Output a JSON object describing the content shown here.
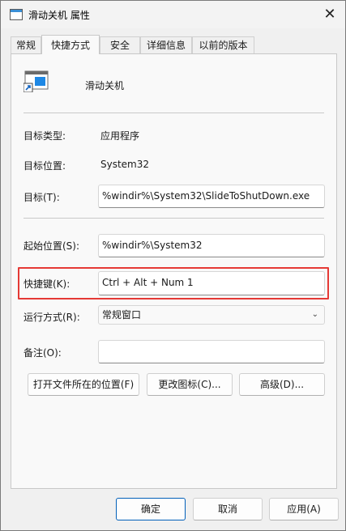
{
  "window": {
    "title": "滑动关机 属性",
    "close_label": "✕"
  },
  "tabs": [
    {
      "label": "常规"
    },
    {
      "label": "快捷方式",
      "active": true
    },
    {
      "label": "安全"
    },
    {
      "label": "详细信息"
    },
    {
      "label": "以前的版本"
    }
  ],
  "shortcut": {
    "name": "滑动关机",
    "target_type_label": "目标类型:",
    "target_type_value": "应用程序",
    "target_location_label": "目标位置:",
    "target_location_value": "System32",
    "target_label": "目标(T):",
    "target_value": "%windir%\\System32\\SlideToShutDown.exe",
    "start_in_label": "起始位置(S):",
    "start_in_value": "%windir%\\System32",
    "hotkey_label": "快捷键(K):",
    "hotkey_value": "Ctrl + Alt + Num 1",
    "run_label": "运行方式(R):",
    "run_value": "常规窗口",
    "comment_label": "备注(O):",
    "comment_value": ""
  },
  "actions": {
    "open_location": "打开文件所在的位置(F)",
    "change_icon": "更改图标(C)...",
    "advanced": "高级(D)..."
  },
  "footer": {
    "ok": "确定",
    "cancel": "取消",
    "apply": "应用(A)"
  },
  "colors": {
    "highlight": "#e53935",
    "accent": "#005fb8"
  }
}
